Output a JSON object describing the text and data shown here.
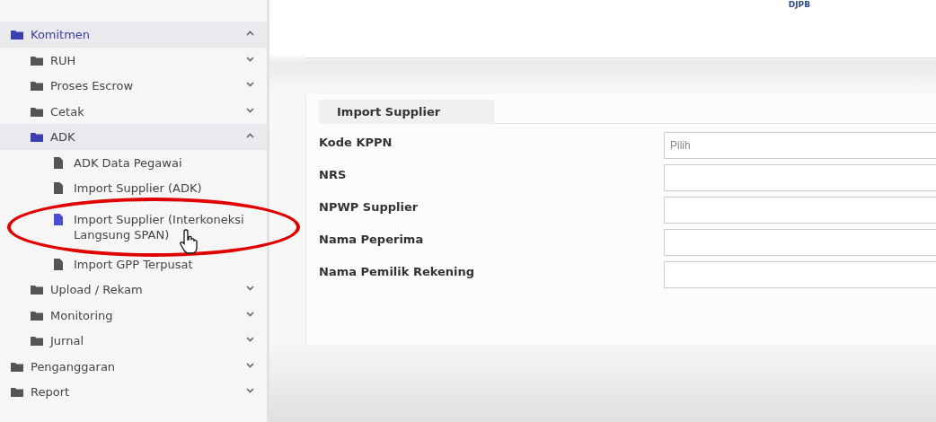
{
  "header": {
    "logo_text": "DJPB"
  },
  "sidebar": {
    "items": [
      {
        "label": "Komitmen",
        "kind": "folder",
        "expanded": true,
        "children": [
          {
            "label": "RUH",
            "kind": "folder",
            "expanded": false
          },
          {
            "label": "Proses Escrow",
            "kind": "folder",
            "expanded": false
          },
          {
            "label": "Cetak",
            "kind": "folder",
            "expanded": false
          },
          {
            "label": "ADK",
            "kind": "folder",
            "expanded": true,
            "children": [
              {
                "label": "ADK Data Pegawai",
                "kind": "file",
                "selected": false
              },
              {
                "label": "Import Supplier (ADK)",
                "kind": "file",
                "selected": false
              },
              {
                "label": "Import Supplier (Interkoneksi Langsung SPAN)",
                "kind": "file",
                "selected": true
              },
              {
                "label": "Import GPP Terpusat",
                "kind": "file",
                "selected": false
              }
            ]
          },
          {
            "label": "Upload / Rekam",
            "kind": "folder",
            "expanded": false
          },
          {
            "label": "Monitoring",
            "kind": "folder",
            "expanded": false
          },
          {
            "label": "Jurnal",
            "kind": "folder",
            "expanded": false
          }
        ]
      },
      {
        "label": "Penganggaran",
        "kind": "folder",
        "expanded": false
      },
      {
        "label": "Report",
        "kind": "folder",
        "expanded": false
      }
    ]
  },
  "form": {
    "title": "Import Supplier",
    "fields": [
      {
        "label": "Kode KPPN",
        "kind": "select",
        "placeholder": "Pilih"
      },
      {
        "label": "NRS",
        "kind": "text"
      },
      {
        "label": "NPWP Supplier",
        "kind": "text"
      },
      {
        "label": "Nama Peperima",
        "kind": "text"
      },
      {
        "label": "Nama Pemilik Rekening",
        "kind": "text"
      }
    ]
  }
}
